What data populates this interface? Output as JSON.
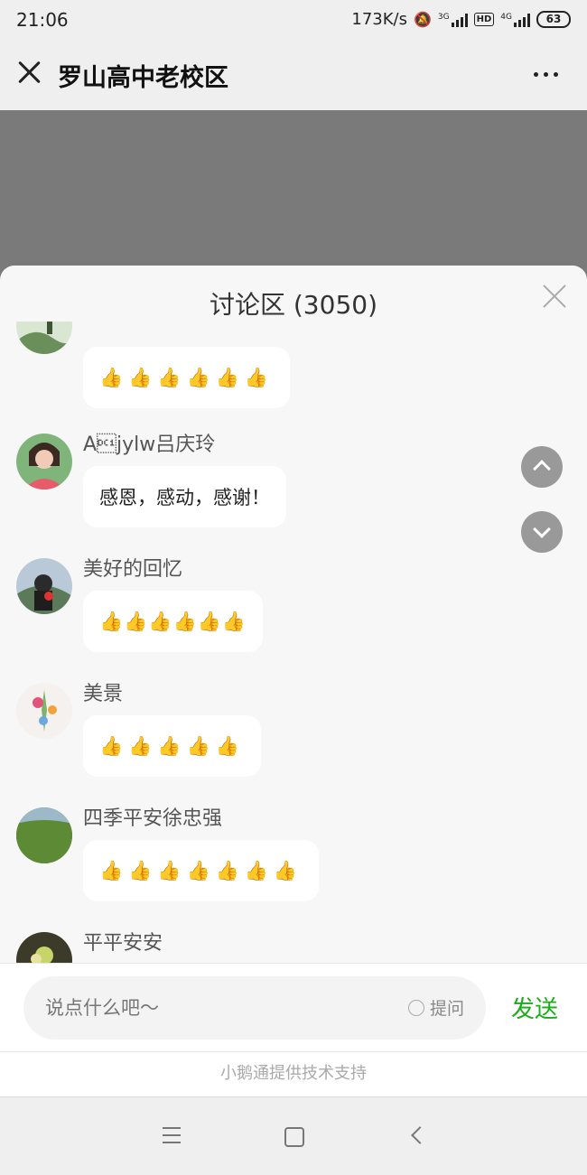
{
  "status_bar": {
    "time": "21:06",
    "net_speed": "173K/s",
    "sim1": "3G",
    "sim2": "4G",
    "hd": "HD",
    "battery": "63"
  },
  "header": {
    "title": "罗山高中老校区"
  },
  "discussion": {
    "title": "讨论区 (3050)",
    "messages": [
      {
        "user": "",
        "text": "👍👍👍👍👍👍"
      },
      {
        "user": "A\u0011jylw吕庆玲",
        "text": "感恩，感动，感谢！"
      },
      {
        "user": "美好的回忆",
        "text": "👍👍👍👍👍👍"
      },
      {
        "user": "美景",
        "text": "👍👍👍👍👍"
      },
      {
        "user": "四季平安徐忠强",
        "text": "👍👍👍👍👍👍👍"
      },
      {
        "user": "平平安安",
        "text": ""
      }
    ]
  },
  "compose": {
    "placeholder": "说点什么吧～",
    "ask_label": "提问",
    "send_label": "发送"
  },
  "footer": {
    "support_text": "小鹅通提供技术支持"
  },
  "colors": {
    "send_green": "#1aad19",
    "overlay_gray": "#7a7a7a"
  }
}
